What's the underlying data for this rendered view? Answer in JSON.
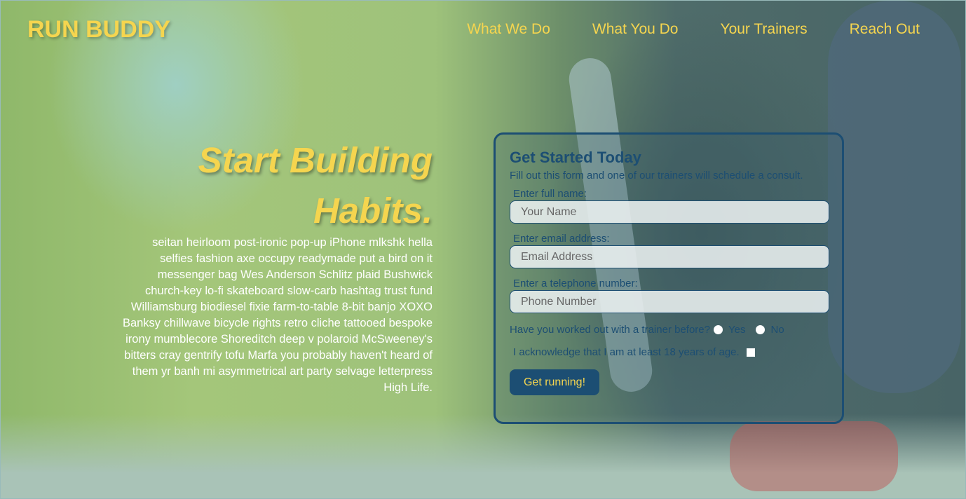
{
  "header": {
    "logo": "RUN BUDDY",
    "nav": [
      "What We Do",
      "What You Do",
      "Your Trainers",
      "Reach Out"
    ]
  },
  "hero": {
    "title_line1": "Start Building",
    "title_line2": "Habits.",
    "body": "seitan heirloom post-ironic pop-up iPhone mlkshk hella selfies fashion axe occupy readymade put a bird on it messenger bag Wes Anderson Schlitz plaid Bushwick church-key lo-fi skateboard slow-carb hashtag trust fund Williamsburg biodiesel fixie farm-to-table 8-bit banjo XOXO Banksy chillwave bicycle rights retro cliche tattooed bespoke irony mumblecore Shoreditch deep v polaroid McSweeney's bitters cray gentrify tofu Marfa you probably haven't heard of them yr banh mi asymmetrical art party selvage letterpress High Life."
  },
  "form": {
    "title": "Get Started Today",
    "subtitle": "Fill out this form and one of our trainers will schedule a consult.",
    "name_label": "Enter full name:",
    "name_placeholder": "Your Name",
    "email_label": "Enter email address:",
    "email_placeholder": "Email Address",
    "phone_label": "Enter a telephone number:",
    "phone_placeholder": "Phone Number",
    "trainer_question": "Have you worked out with a trainer before?",
    "yes": "Yes",
    "no": "No",
    "ack": "I acknowledge that I am at least 18 years of age.",
    "submit": "Get running!"
  }
}
